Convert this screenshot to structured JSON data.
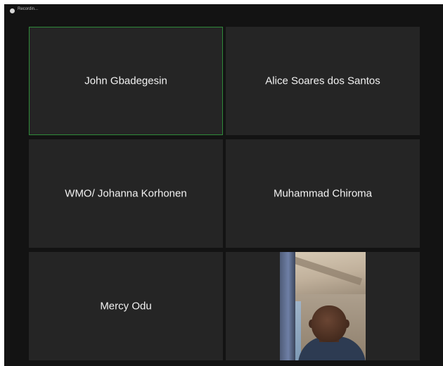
{
  "window": {
    "recording_label": "Recordin..."
  },
  "participants": [
    {
      "name": "John Gbadegesin",
      "active_speaker": true
    },
    {
      "name": "Alice Soares dos Santos",
      "active_speaker": false
    },
    {
      "name": "WMO/ Johanna Korhonen",
      "active_speaker": false
    },
    {
      "name": "Muhammad Chiroma",
      "active_speaker": false
    },
    {
      "name": "Mercy Odu",
      "active_speaker": false
    },
    {
      "name": "",
      "video_on": true
    }
  ],
  "colors": {
    "background": "#131313",
    "tile": "#252525",
    "active_border": "#2f8a3a",
    "name_text": "#f2f2f2"
  }
}
